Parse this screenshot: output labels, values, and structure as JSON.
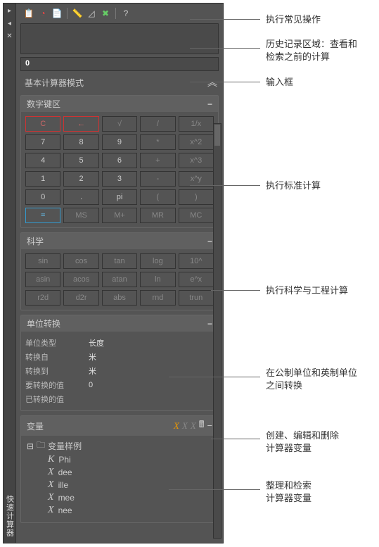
{
  "sidebar": {
    "title": "快速计算器"
  },
  "toolbar": {
    "icons": [
      "clipboard-icon",
      "clock-icon",
      "paste-icon",
      "sep",
      "ruler-icon",
      "angle-icon",
      "intersect-icon",
      "sep",
      "help-icon"
    ]
  },
  "input": {
    "value": "0"
  },
  "mode": {
    "label": "基本计算器模式"
  },
  "sections": {
    "numpad": {
      "title": "数字键区",
      "keys": [
        {
          "t": "C",
          "cls": "red"
        },
        {
          "t": "←",
          "cls": "red"
        },
        {
          "t": "√",
          "cls": "ghost"
        },
        {
          "t": "/",
          "cls": "ghost"
        },
        {
          "t": "1/x",
          "cls": "ghost"
        },
        {
          "t": "7"
        },
        {
          "t": "8"
        },
        {
          "t": "9"
        },
        {
          "t": "*",
          "cls": "ghost"
        },
        {
          "t": "x^2",
          "cls": "ghost"
        },
        {
          "t": "4"
        },
        {
          "t": "5"
        },
        {
          "t": "6"
        },
        {
          "t": "+",
          "cls": "ghost"
        },
        {
          "t": "x^3",
          "cls": "ghost"
        },
        {
          "t": "1"
        },
        {
          "t": "2"
        },
        {
          "t": "3"
        },
        {
          "t": "-",
          "cls": "ghost"
        },
        {
          "t": "x^y",
          "cls": "ghost"
        },
        {
          "t": "0"
        },
        {
          "t": "."
        },
        {
          "t": "pi"
        },
        {
          "t": "(",
          "cls": "ghost"
        },
        {
          "t": ")",
          "cls": "ghost"
        },
        {
          "t": "=",
          "cls": "blue"
        },
        {
          "t": "MS",
          "cls": "ghost"
        },
        {
          "t": "M+",
          "cls": "ghost"
        },
        {
          "t": "MR",
          "cls": "ghost"
        },
        {
          "t": "MC",
          "cls": "ghost"
        }
      ]
    },
    "science": {
      "title": "科学",
      "keys": [
        {
          "t": "sin"
        },
        {
          "t": "cos"
        },
        {
          "t": "tan"
        },
        {
          "t": "log"
        },
        {
          "t": "10^"
        },
        {
          "t": "asin"
        },
        {
          "t": "acos"
        },
        {
          "t": "atan"
        },
        {
          "t": "ln"
        },
        {
          "t": "e^x"
        },
        {
          "t": "r2d"
        },
        {
          "t": "d2r"
        },
        {
          "t": "abs"
        },
        {
          "t": "rnd"
        },
        {
          "t": "trun"
        }
      ]
    },
    "units": {
      "title": "单位转换",
      "rows": {
        "type_lbl": "单位类型",
        "type_val": "长度",
        "from_lbl": "转换自",
        "from_val": "米",
        "to_lbl": "转换到",
        "to_val": "米",
        "in_lbl": "要转换的值",
        "in_val": "0",
        "out_lbl": "已转换的值",
        "out_val": ""
      }
    },
    "vars": {
      "title": "变量",
      "root": "变量样例",
      "items": [
        "Phi",
        "dee",
        "ille",
        "mee",
        "nee"
      ]
    }
  },
  "callouts": {
    "c1": "执行常见操作",
    "c2a": "历史记录区域：查看和",
    "c2b": "检索之前的计算",
    "c3": "输入框",
    "c4": "执行标准计算",
    "c5": "执行科学与工程计算",
    "c6a": "在公制单位和英制单位",
    "c6b": "之间转换",
    "c7a": "创建、编辑和删除",
    "c7b": "计算器变量",
    "c8a": "整理和检索",
    "c8b": "计算器变量"
  }
}
